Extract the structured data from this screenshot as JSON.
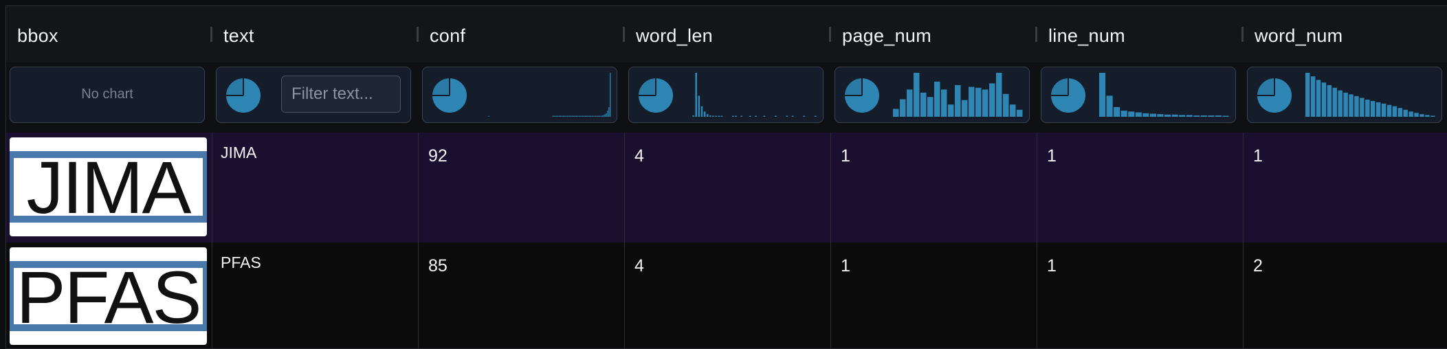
{
  "columns": [
    {
      "key": "bbox",
      "label": "bbox"
    },
    {
      "key": "text",
      "label": "text"
    },
    {
      "key": "conf",
      "label": "conf"
    },
    {
      "key": "word_len",
      "label": "word_len"
    },
    {
      "key": "page_num",
      "label": "page_num"
    },
    {
      "key": "line_num",
      "label": "line_num"
    },
    {
      "key": "word_num",
      "label": "word_num"
    }
  ],
  "filters": {
    "bbox_no_chart": "No chart",
    "text_placeholder": "Filter text..."
  },
  "colors": {
    "accent": "#2e86b5",
    "row_selected_bg": "#1a0f2e",
    "bbox_outline": "#4879aa"
  },
  "histograms": {
    "conf": [
      0,
      0,
      0,
      0,
      0,
      0,
      1,
      0,
      0,
      0,
      0,
      0,
      0,
      0,
      0,
      0,
      0,
      0,
      0,
      0,
      0,
      0,
      0,
      0,
      0,
      0,
      0,
      0,
      0,
      0,
      0,
      0,
      0,
      0,
      0,
      0,
      0,
      0,
      0,
      0,
      0,
      0,
      0,
      0,
      0,
      0,
      0,
      0,
      0,
      0,
      0,
      0,
      0,
      0,
      0,
      1,
      1,
      1,
      1,
      1,
      1,
      1,
      1,
      1,
      1,
      1,
      1,
      1,
      1,
      1,
      1,
      1,
      1,
      1,
      1,
      1,
      1,
      1,
      1,
      1,
      1,
      1,
      1,
      1,
      1,
      1,
      1,
      1,
      1,
      1,
      2,
      2,
      2,
      3,
      4,
      6,
      8,
      14,
      22,
      100
    ],
    "word_len": [
      0,
      0,
      3,
      100,
      48,
      24,
      12,
      6,
      3,
      2,
      1,
      1,
      1,
      0,
      0,
      0,
      1,
      1,
      0,
      1,
      0,
      0,
      1,
      0,
      1,
      0,
      0,
      1,
      0,
      0,
      0,
      1,
      0,
      0,
      0,
      1,
      0,
      1,
      0,
      0,
      0,
      1,
      0,
      0,
      0,
      1
    ],
    "page_num": [
      18,
      40,
      62,
      100,
      55,
      45,
      80,
      62,
      28,
      72,
      38,
      68,
      66,
      62,
      76,
      100,
      52,
      28,
      16
    ],
    "line_num": [
      100,
      48,
      22,
      14,
      12,
      10,
      8,
      7,
      6,
      5,
      5,
      4,
      4,
      3,
      3,
      3,
      3,
      2
    ],
    "word_num": [
      100,
      92,
      84,
      78,
      72,
      66,
      60,
      55,
      51,
      47,
      43,
      39,
      36,
      33,
      30,
      27,
      24,
      20,
      16,
      12,
      9,
      6,
      4,
      2
    ]
  },
  "rows": [
    {
      "bbox_word": "JIMA",
      "text": "JIMA",
      "conf": "92",
      "word_len": "4",
      "page_num": "1",
      "line_num": "1",
      "word_num": "1"
    },
    {
      "bbox_word": "PFAS",
      "text": "PFAS",
      "conf": "85",
      "word_len": "4",
      "page_num": "1",
      "line_num": "1",
      "word_num": "2"
    }
  ]
}
